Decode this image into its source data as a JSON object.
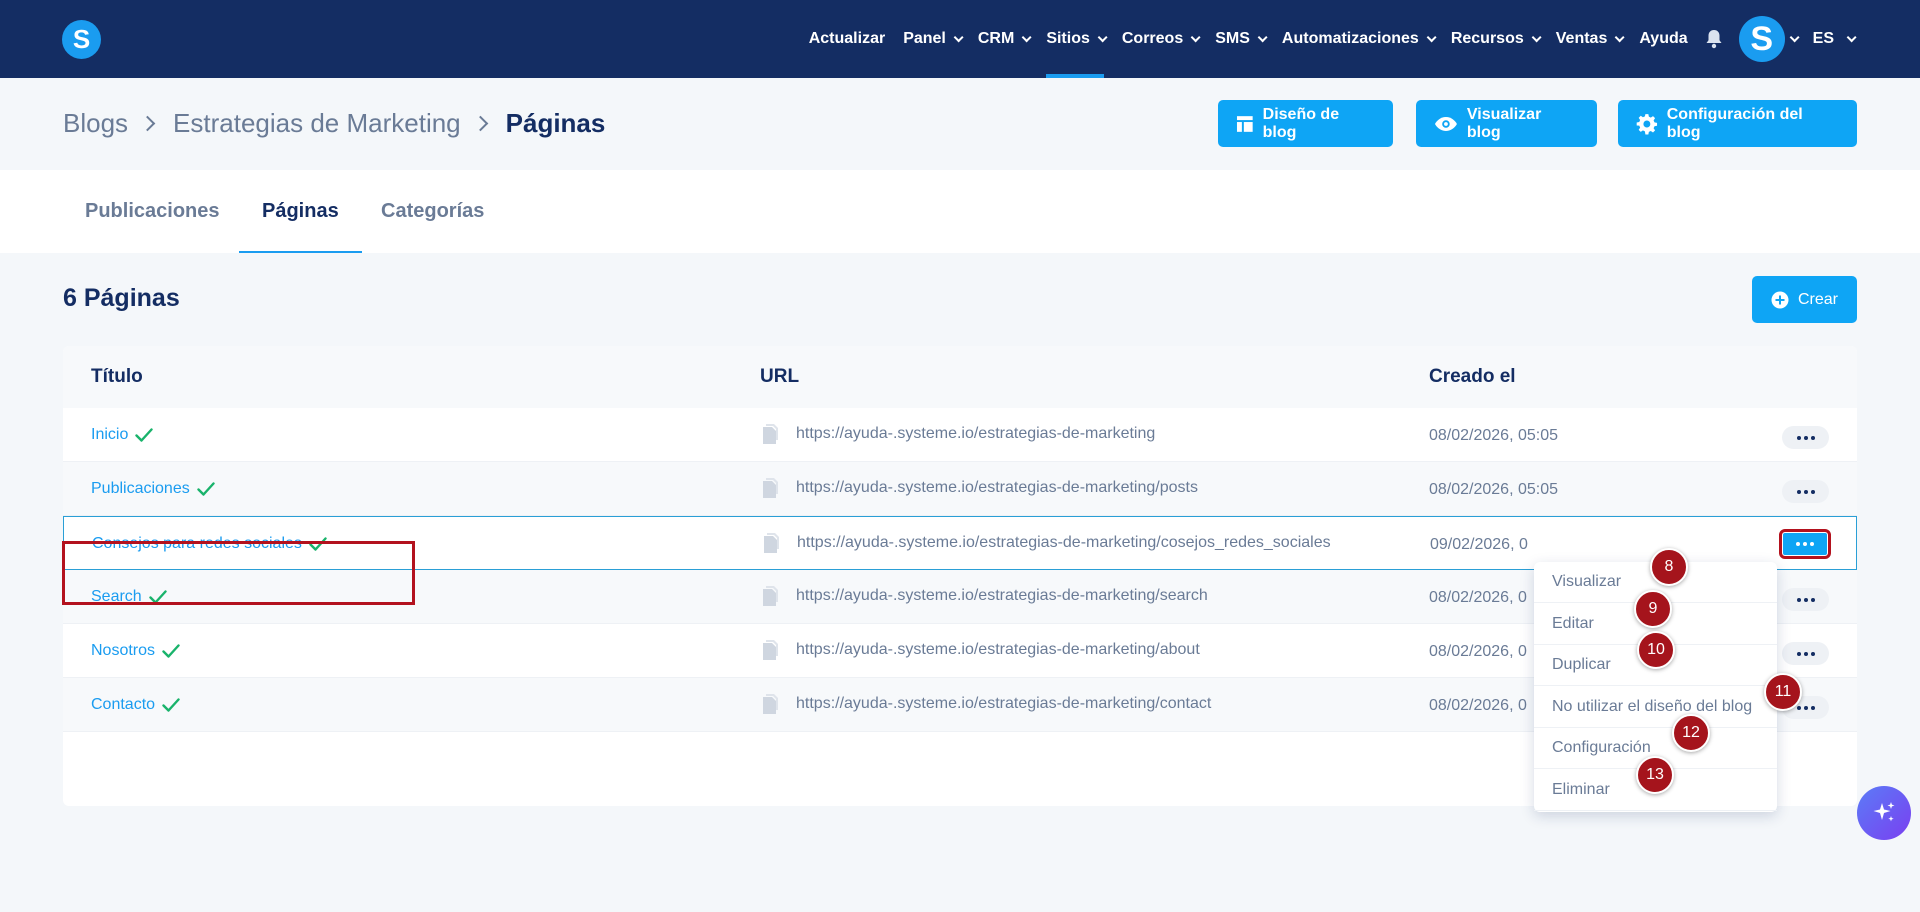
{
  "nav": {
    "logo": "S",
    "items": [
      {
        "label": "Actualizar",
        "chevron": false,
        "active": false
      },
      {
        "label": "Panel",
        "chevron": true,
        "active": false
      },
      {
        "label": "CRM",
        "chevron": true,
        "active": false
      },
      {
        "label": "Sitios",
        "chevron": true,
        "active": true
      },
      {
        "label": "Correos",
        "chevron": true,
        "active": false
      },
      {
        "label": "SMS",
        "chevron": true,
        "active": false
      },
      {
        "label": "Automatizaciones",
        "chevron": true,
        "active": false
      },
      {
        "label": "Recursos",
        "chevron": true,
        "active": false
      },
      {
        "label": "Ventas",
        "chevron": true,
        "active": false
      },
      {
        "label": "Ayuda",
        "chevron": false,
        "active": false
      }
    ],
    "avatar": "S",
    "language": "ES"
  },
  "breadcrumb": {
    "blogs": "Blogs",
    "blog": "Estrategias de Marketing",
    "current": "Páginas"
  },
  "header_buttons": {
    "design": "Diseño de blog",
    "view": "Visualizar blog",
    "settings": "Configuración del blog"
  },
  "tabs": {
    "posts": "Publicaciones",
    "pages": "Páginas",
    "categories": "Categorías"
  },
  "count_title": "6 Páginas",
  "create_label": "Crear",
  "table": {
    "headers": {
      "title": "Título",
      "url": "URL",
      "created": "Creado el"
    },
    "rows": [
      {
        "title": "Inicio",
        "url": "https://ayuda-.systeme.io/estrategias-de-marketing",
        "date": "08/02/2026, 05:05"
      },
      {
        "title": "Publicaciones",
        "url": "https://ayuda-.systeme.io/estrategias-de-marketing/posts",
        "date": "08/02/2026, 05:05"
      },
      {
        "title": "Consejos para redes sociales",
        "url": "https://ayuda-.systeme.io/estrategias-de-marketing/cosejos_redes_sociales",
        "date": "09/02/2026, 0"
      },
      {
        "title": "Search",
        "url": "https://ayuda-.systeme.io/estrategias-de-marketing/search",
        "date": "08/02/2026, 0"
      },
      {
        "title": "Nosotros",
        "url": "https://ayuda-.systeme.io/estrategias-de-marketing/about",
        "date": "08/02/2026, 0"
      },
      {
        "title": "Contacto",
        "url": "https://ayuda-.systeme.io/estrategias-de-marketing/contact",
        "date": "08/02/2026, 0"
      }
    ]
  },
  "menu": {
    "items": [
      {
        "label": "Visualizar",
        "badge": "8"
      },
      {
        "label": "Editar",
        "badge": "9"
      },
      {
        "label": "Duplicar",
        "badge": "10"
      },
      {
        "label": "No utilizar el diseño del blog",
        "badge": "11"
      },
      {
        "label": "Configuración",
        "badge": "12"
      },
      {
        "label": "Eliminar",
        "badge": "13"
      }
    ]
  },
  "colors": {
    "nav_bg": "#142d63",
    "accent": "#0ea5f5",
    "highlight": "#b3121e",
    "check": "#19b36b"
  }
}
